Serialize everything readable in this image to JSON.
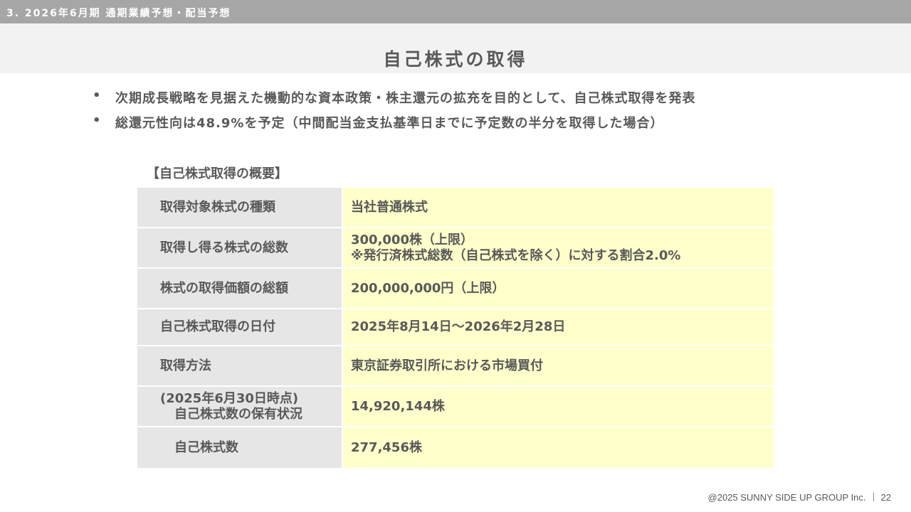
{
  "header": {
    "section_label": "3. 2026年6月期 通期業績予想・配当予想",
    "page_title": "自己株式の取得"
  },
  "bullets": [
    "次期成長戦略を見据えた機動的な資本政策・株主還元の拡充を目的として、自己株式取得を発表",
    "総還元性向は48.9%を予定（中間配当金支払基準日までに予定数の半分を取得した場合）"
  ],
  "bullet_symbol": "•",
  "summary": {
    "heading": "【自己株式取得の概要】",
    "rows": [
      {
        "label": "取得対象株式の種類",
        "value": "当社普通株式"
      },
      {
        "label": "取得し得る株式の総数",
        "value": "300,000株（上限）",
        "value_note": "※発行済株式総数（自己株式を除く）に対する割合2.0%"
      },
      {
        "label": "株式の取得価額の総額",
        "value": "200,000,000円（上限）"
      },
      {
        "label": "自己株式取得の日付",
        "value": "2025年8月14日～2026年2月28日"
      },
      {
        "label": "取得方法",
        "value": "東京証券取引所における市場買付"
      },
      {
        "label_line1": "(2025年6月30日時点)",
        "label_line2": "自己株式数の保有状況",
        "value": "14,920,144株"
      },
      {
        "label": "自己株式数",
        "value": "277,456株"
      }
    ]
  },
  "footer": {
    "copyright": "@2025 SUNNY SIDE UP GROUP Inc.",
    "page_number": "22"
  },
  "colors": {
    "top_bar": "#a6a6a6",
    "title_band": "#f2f2f2",
    "label_cell": "#e6e6e6",
    "value_cell": "#ffffcc",
    "text": "#595959"
  }
}
